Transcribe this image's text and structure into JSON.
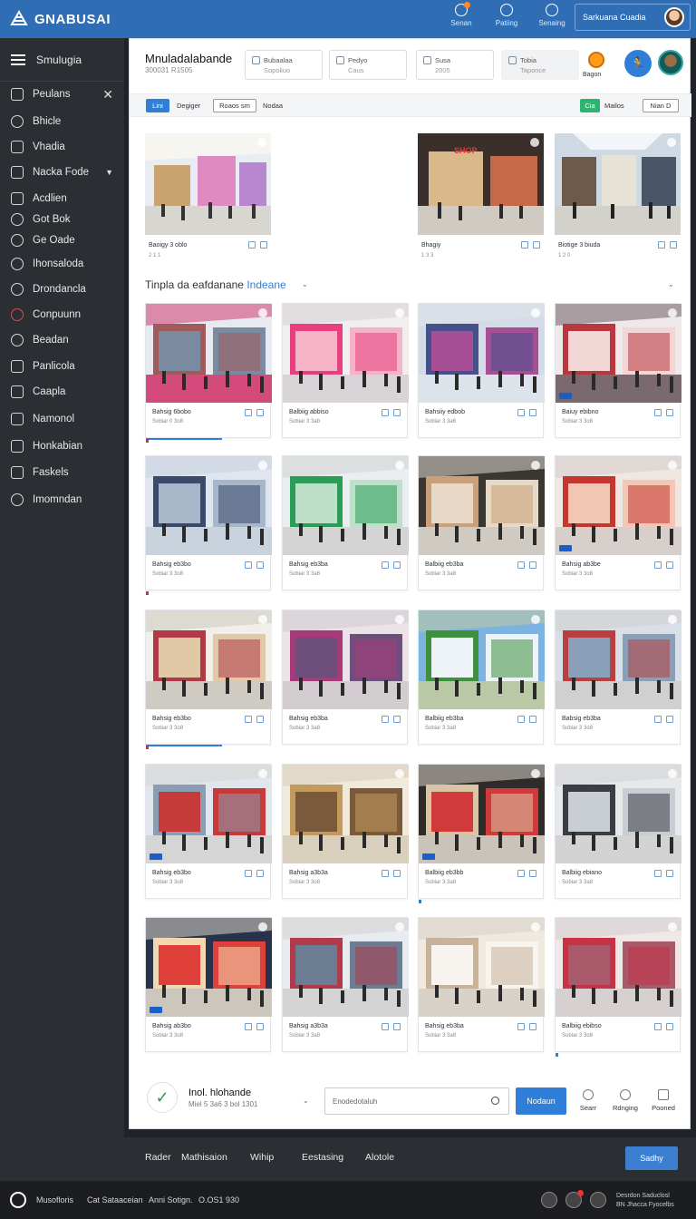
{
  "app": {
    "name": "GNABUSAI"
  },
  "topbar": {
    "icons": [
      {
        "label": "Senan",
        "icon": "notification-icon"
      },
      {
        "label": "Patiing",
        "icon": "clock-icon"
      },
      {
        "label": "Senaing",
        "icon": "settings-icon"
      }
    ],
    "user_label": "Sarkuana Cuadia"
  },
  "sidebar": {
    "title": "Smulugia",
    "items": [
      {
        "label": "Peulans",
        "icon": "edit-icon"
      },
      {
        "label": "Bhicle",
        "icon": "link-icon"
      },
      {
        "label": "Vhadia",
        "icon": "bar-chart-icon"
      },
      {
        "label": "Nacka Fode",
        "icon": "folder-icon"
      },
      {
        "label": "Acdlien",
        "icon": "tools-icon"
      },
      {
        "label": "Got Bok",
        "icon": "globe-icon"
      },
      {
        "label": "Ge Oade",
        "icon": "gear-icon"
      },
      {
        "label": "Ihonsaloda",
        "icon": "user-icon"
      },
      {
        "label": "Drondancla",
        "icon": "shield-icon"
      },
      {
        "label": "Conpuunn",
        "icon": "power-icon"
      },
      {
        "label": "Beadan",
        "icon": "search-icon"
      },
      {
        "label": "Panlicola",
        "icon": "grid-icon"
      },
      {
        "label": "Caapla",
        "icon": "lock-icon"
      },
      {
        "label": "Namonol",
        "icon": "sliders-icon"
      },
      {
        "label": "Honkabian",
        "icon": "box-icon"
      },
      {
        "label": "Faskels",
        "icon": "puzzle-icon"
      },
      {
        "label": "Imomndan",
        "icon": "cloud-icon"
      }
    ]
  },
  "header": {
    "title": "Mnuladalabande",
    "subtitle": "300031 R1505",
    "stats": [
      {
        "label": "Bubaalaa",
        "value": "Sopoliuo"
      },
      {
        "label": "Pedyo",
        "value": "Caus"
      },
      {
        "label": "Susa",
        "value": "2005"
      },
      {
        "label": "Tobia",
        "value": "Taponce"
      }
    ],
    "bell_label": "Bagon"
  },
  "filters": {
    "chip1": "Lini",
    "text1": "Degiger",
    "box1": "Roaos sm",
    "text2": "Nodaa",
    "chip2": "Cia",
    "text3": "Mailos",
    "box2": "Nian D"
  },
  "featured": [
    {
      "title": "Baoigy 3 oblo",
      "meta": "2 1 1"
    },
    {
      "title": "Bhagiy",
      "meta": "1 3 3"
    },
    {
      "title": "Biotige 3 biuda",
      "meta": "1 2 0"
    }
  ],
  "section": {
    "title": "Tinpla da eafdanane",
    "highlight": "Indeane"
  },
  "grid": [
    {
      "title": "Bahsig 6bobo",
      "meta": "Sobiar 0 3o8"
    },
    {
      "title": "Balbiig abbiso",
      "meta": "Sobiar 3 3ab"
    },
    {
      "title": "Bahsiiy edbob",
      "meta": "Sobiar 3 3a6"
    },
    {
      "title": "Baiuy ebibno",
      "meta": "Sobiar 3 3o8"
    },
    {
      "title": "Bahsig eb3bo",
      "meta": "Sobiar 3 3o8"
    },
    {
      "title": "Bahsig eb3ba",
      "meta": "Sobiar 3 3a6"
    },
    {
      "title": "Balbiig eb3ba",
      "meta": "Sobiar 3 3a8"
    },
    {
      "title": "Bahsig ab3be",
      "meta": "Sobiar 3 3o8"
    },
    {
      "title": "Bahsig eb3bo",
      "meta": "Sobiar 3 3o8"
    },
    {
      "title": "Bahsig eb3ba",
      "meta": "Sobiar 3 3a8"
    },
    {
      "title": "Balbiig eb3ba",
      "meta": "Sobiar 3 3a8"
    },
    {
      "title": "Babsig eb3ba",
      "meta": "Sobiar 3 3o8"
    },
    {
      "title": "Bahsig eb3bo",
      "meta": "Sobiar 3 3o8"
    },
    {
      "title": "Bahsig a3b3a",
      "meta": "Sobiar 3 3o8"
    },
    {
      "title": "Balbiig eb3bb",
      "meta": "Sobiar 3 3a8"
    },
    {
      "title": "Balbiig ebiano",
      "meta": "Sobiar 3 3a8"
    },
    {
      "title": "Bahsig ab3bo",
      "meta": "Sobiar 3 3o8"
    },
    {
      "title": "Bahsig a3b3a",
      "meta": "Sobiar 3 3a8"
    },
    {
      "title": "Bahsig eb3ba",
      "meta": "Sobiar 3 3a8"
    },
    {
      "title": "Balbiig ebibso",
      "meta": "Sobiar 3 3o8"
    }
  ],
  "footer": {
    "title": "Inol. hlohande",
    "subtitle": "Miel 5 3a6 3 bol 1301",
    "search_placeholder": "Enodedotaluh",
    "button": "Nodaun",
    "actions": [
      {
        "label": "Searr",
        "icon": "globe-icon"
      },
      {
        "label": "Rdnging",
        "icon": "gear-icon"
      },
      {
        "label": "Pooned",
        "icon": "trash-icon"
      }
    ]
  },
  "bottombar": {
    "links": [
      "Rader",
      "Mathisaion",
      "Wihip",
      "Eestasing",
      "Alotole"
    ],
    "button": "Sadhy"
  },
  "statusbar": {
    "texts": [
      "Musofloris",
      "Cat Sataaceian",
      "Anni Sotign.",
      "O.OS1 930"
    ],
    "right1": "Desrdon Saduclosl",
    "right2": "BN Jhacca Fyocelbs"
  },
  "colors": {
    "accent": "#2f7ed8",
    "topbar": "#2f6db5",
    "sidebar": "#2b2e33",
    "success": "#2db46e"
  }
}
